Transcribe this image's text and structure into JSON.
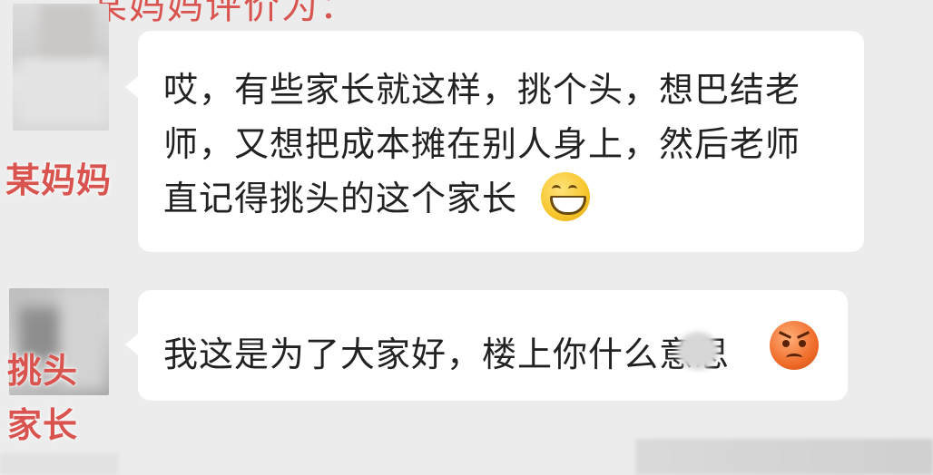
{
  "chat": {
    "cut_top_text": "某妈妈评价为：",
    "messages": [
      {
        "sender": "某妈妈",
        "lines": [
          "哎，有些家长就这样，挑个头，想巴结老",
          "师，又想把成本摊在别人身上，然后老师",
          "直记得挑头的这个家长"
        ],
        "emoji": "grinning-face-icon"
      },
      {
        "sender_line1": "挑头",
        "sender_line2": "家长",
        "lines": [
          "我这是为了大家好，楼上你什么意思"
        ],
        "emoji": "angry-face-icon"
      }
    ]
  },
  "colors": {
    "background": "#ececec",
    "bubble": "#ffffff",
    "name_label": "#d9534f",
    "text": "#222222"
  }
}
